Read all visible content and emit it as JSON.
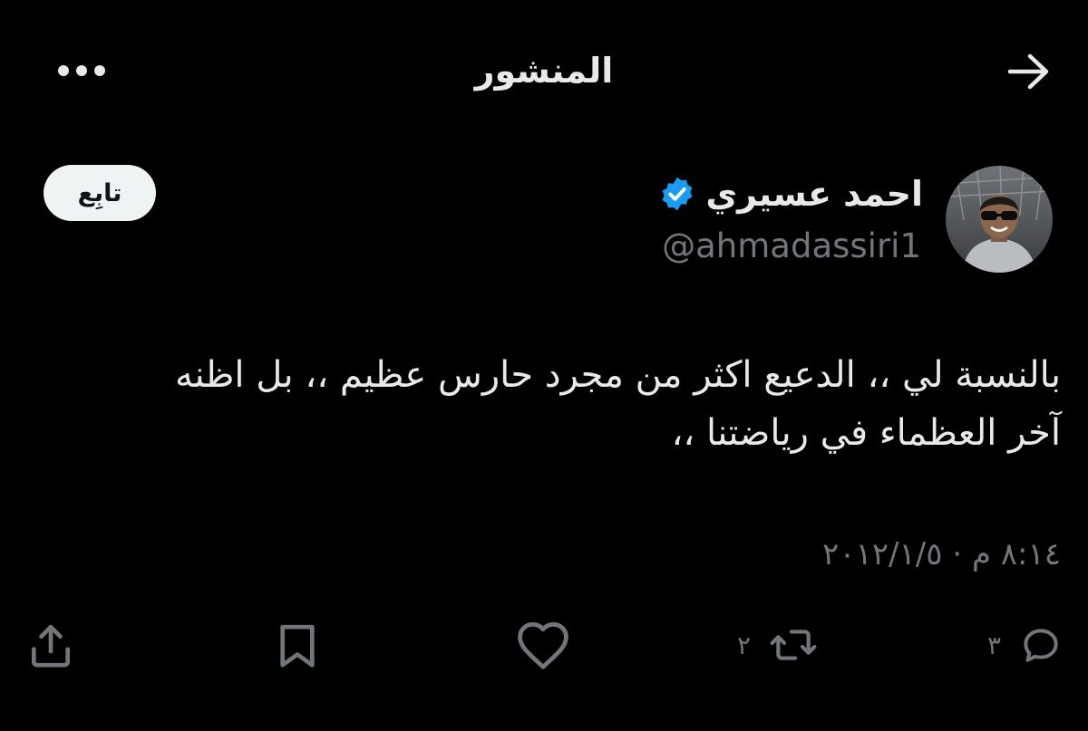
{
  "header": {
    "title": "المنشور",
    "back_icon": "arrow-right-icon",
    "more_icon": "more-dots-icon"
  },
  "author": {
    "display_name": "احمد عسيري",
    "handle": "@ahmadassiri1",
    "verified_icon": "verified-badge-icon",
    "verified_color": "#1d9bf0",
    "follow_label": "تابِع"
  },
  "post": {
    "lines": [
      "بالنسبة لي ،، الدعيع اكثر من مجرد حارس عظيم ،، بل اظنه",
      "آخر العظماء في رياضتنا ،،"
    ],
    "timestamp": "٨:١٤ م · ٢٠١٢/١/٥"
  },
  "actions": {
    "reply_count": "٣",
    "repost_count": "٢",
    "icons": [
      "reply-icon",
      "repost-icon",
      "like-icon",
      "bookmark-icon",
      "share-icon"
    ]
  },
  "colors": {
    "background": "#000000",
    "text": "#e7e9ea",
    "secondary": "#71767b",
    "accent": "#1d9bf0"
  }
}
